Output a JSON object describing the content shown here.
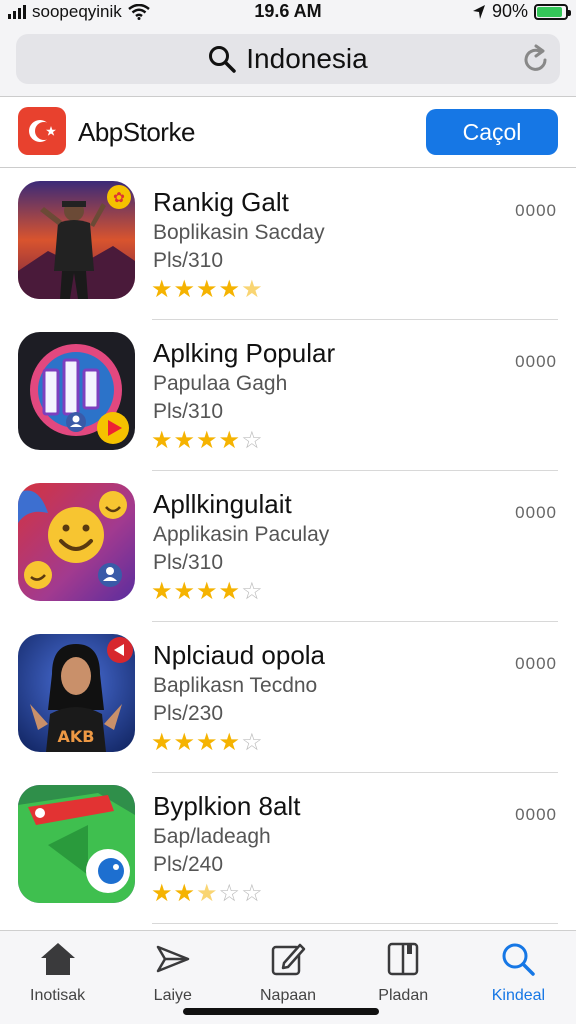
{
  "status_bar": {
    "carrier": "soopeqyinik",
    "time": "19.6 AM",
    "battery_percent": "90%",
    "battery_level": 0.9
  },
  "search": {
    "query": "Indonesia"
  },
  "header": {
    "store_name": "AbpStorke",
    "cancel_label": "Caçol",
    "accent_color": "#1677e5",
    "logo_color": "#e8412e"
  },
  "apps": [
    {
      "title": "Rankig Galt",
      "subtitle": "Boplikasin Sacday",
      "size": "Pls/310",
      "rating": 4.5,
      "menu": "0000",
      "icon": "dancer-photo-icon"
    },
    {
      "title": "Aplking Popular",
      "subtitle": "Papulaa Gagh",
      "size": "Pls/310",
      "rating": 4,
      "menu": "0000",
      "icon": "bar-chart-app-icon"
    },
    {
      "title": "Apllkingulait",
      "subtitle": "Applikasin Paculay",
      "size": "Pls/310",
      "rating": 4,
      "menu": "0000",
      "icon": "emoji-app-icon"
    },
    {
      "title": "Nplciaud opola",
      "subtitle": "Baplikasn Tecdno",
      "size": "Pls/230",
      "rating": 4,
      "menu": "0000",
      "icon": "woman-photo-icon"
    },
    {
      "title": "Byplkion 8alt",
      "subtitle": "Бар/ladeagh",
      "size": "Pls/240",
      "rating": 2.5,
      "menu": "0000",
      "icon": "green-map-icon"
    }
  ],
  "tabs": [
    {
      "label": "Inotisak",
      "icon": "home-icon",
      "active": false
    },
    {
      "label": "Laiye",
      "icon": "paper-plane-icon",
      "active": false
    },
    {
      "label": "Napaan",
      "icon": "edit-icon",
      "active": false
    },
    {
      "label": "Pladan",
      "icon": "book-icon",
      "active": false
    },
    {
      "label": "Kindeal",
      "icon": "search-icon",
      "active": true
    }
  ]
}
